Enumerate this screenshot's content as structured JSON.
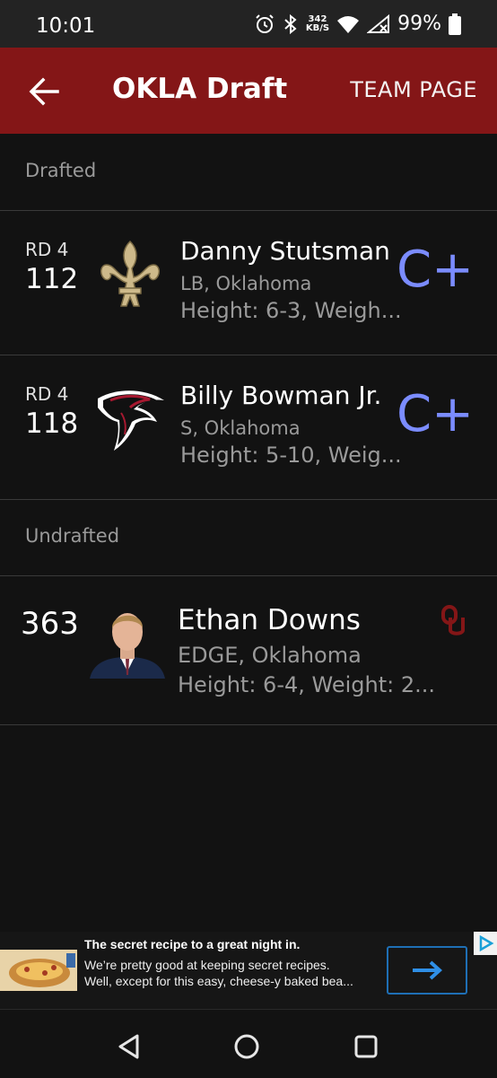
{
  "status_bar": {
    "time": "10:01",
    "net_speed_value": "342",
    "net_speed_unit": "KB/S",
    "battery": "99%"
  },
  "app_bar": {
    "title": "OKLA Draft",
    "team_page_label": "TEAM PAGE"
  },
  "sections": {
    "drafted_label": "Drafted",
    "undrafted_label": "Undrafted"
  },
  "drafted": [
    {
      "round": "RD 4",
      "pick": "112",
      "team_logo": "saints-fleur-de-lis-icon",
      "name": "Danny Stutsman",
      "position_school": "LB, Oklahoma",
      "meta": "Height: 6-3, Weigh...",
      "grade": "C+"
    },
    {
      "round": "RD 4",
      "pick": "118",
      "team_logo": "falcons-logo-icon",
      "name": "Billy Bowman Jr.",
      "position_school": "S, Oklahoma",
      "meta": "Height: 5-10, Weig...",
      "grade": "C+"
    }
  ],
  "undrafted": [
    {
      "rank": "363",
      "name": "Ethan Downs",
      "position_school": "EDGE, Oklahoma",
      "meta": "Height: 6-4, Weight: 2...",
      "school_logo": "oklahoma-ou-icon"
    }
  ],
  "ad": {
    "title": "The secret recipe to a great night in.",
    "line1": "We’re pretty good at keeping secret recipes.",
    "line2": "Well, except for this easy, cheese-y baked bea..."
  },
  "colors": {
    "app_bar": "#841617",
    "grade": "#7b8cff",
    "background": "#121212"
  }
}
